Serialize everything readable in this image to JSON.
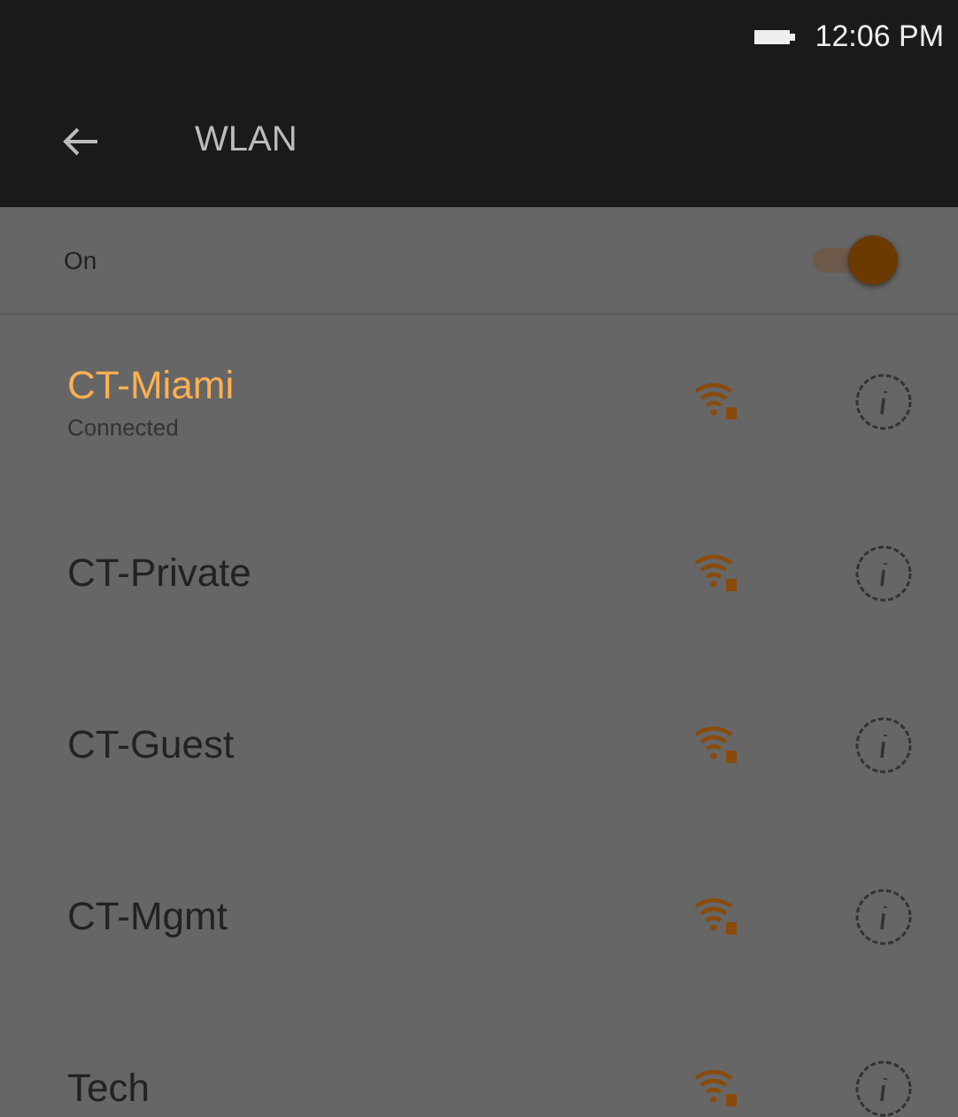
{
  "status_bar": {
    "time": "12:06 PM"
  },
  "toolbar": {
    "title": "WLAN"
  },
  "wlan_switch": {
    "label": "On",
    "on": true
  },
  "networks": [
    {
      "name": "CT-Miami",
      "status": "Connected",
      "connected": true
    },
    {
      "name": "CT-Private",
      "connected": false
    },
    {
      "name": "CT-Guest",
      "connected": false
    },
    {
      "name": "CT-Mgmt",
      "connected": false
    },
    {
      "name": "Tech",
      "connected": false
    }
  ]
}
